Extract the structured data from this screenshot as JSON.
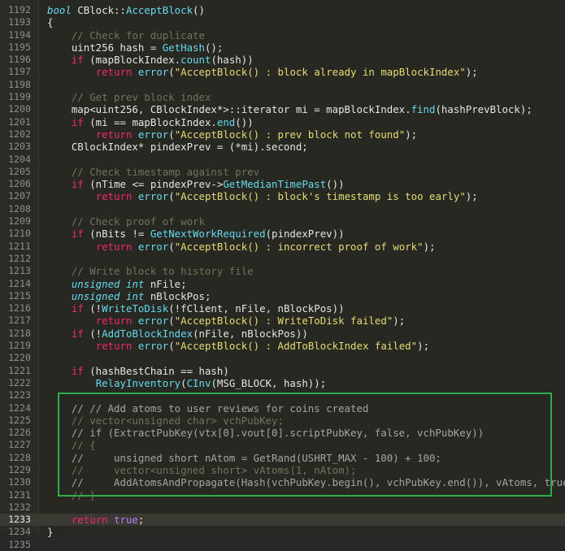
{
  "editor": {
    "current_line": 1233,
    "highlight_color": "#2dad4a",
    "lines": [
      {
        "num": "1192",
        "segs": [
          [
            "type",
            "bool"
          ],
          [
            "pl",
            " CBlock::"
          ],
          [
            "fn",
            "AcceptBlock"
          ],
          [
            "pl",
            "()"
          ]
        ]
      },
      {
        "num": "1193",
        "segs": [
          [
            "pl",
            "{"
          ]
        ]
      },
      {
        "num": "1194",
        "segs": [
          [
            "pl",
            "    "
          ],
          [
            "com",
            "// Check for duplicate"
          ]
        ]
      },
      {
        "num": "1195",
        "segs": [
          [
            "pl",
            "    uint256 hash = "
          ],
          [
            "fn",
            "GetHash"
          ],
          [
            "pl",
            "();"
          ]
        ]
      },
      {
        "num": "1196",
        "segs": [
          [
            "pl",
            "    "
          ],
          [
            "kw",
            "if"
          ],
          [
            "pl",
            " (mapBlockIndex."
          ],
          [
            "fn",
            "count"
          ],
          [
            "pl",
            "(hash))"
          ]
        ]
      },
      {
        "num": "1197",
        "segs": [
          [
            "pl",
            "        "
          ],
          [
            "kw",
            "return"
          ],
          [
            "pl",
            " "
          ],
          [
            "fn",
            "error"
          ],
          [
            "pl",
            "("
          ],
          [
            "str",
            "\"AcceptBlock() : block already in mapBlockIndex\""
          ],
          [
            "pl",
            ");"
          ]
        ]
      },
      {
        "num": "1198",
        "segs": []
      },
      {
        "num": "1199",
        "segs": [
          [
            "pl",
            "    "
          ],
          [
            "com",
            "// Get prev block index"
          ]
        ]
      },
      {
        "num": "1200",
        "segs": [
          [
            "pl",
            "    map<uint256, CBlockIndex*>::iterator mi = mapBlockIndex."
          ],
          [
            "fn",
            "find"
          ],
          [
            "pl",
            "(hashPrevBlock);"
          ]
        ]
      },
      {
        "num": "1201",
        "segs": [
          [
            "pl",
            "    "
          ],
          [
            "kw",
            "if"
          ],
          [
            "pl",
            " (mi == mapBlockIndex."
          ],
          [
            "fn",
            "end"
          ],
          [
            "pl",
            "())"
          ]
        ]
      },
      {
        "num": "1202",
        "segs": [
          [
            "pl",
            "        "
          ],
          [
            "kw",
            "return"
          ],
          [
            "pl",
            " "
          ],
          [
            "fn",
            "error"
          ],
          [
            "pl",
            "("
          ],
          [
            "str",
            "\"AcceptBlock() : prev block not found\""
          ],
          [
            "pl",
            ");"
          ]
        ]
      },
      {
        "num": "1203",
        "segs": [
          [
            "pl",
            "    CBlockIndex* pindexPrev = (*mi).second;"
          ]
        ]
      },
      {
        "num": "1204",
        "segs": []
      },
      {
        "num": "1205",
        "segs": [
          [
            "pl",
            "    "
          ],
          [
            "com",
            "// Check timestamp against prev"
          ]
        ]
      },
      {
        "num": "1206",
        "segs": [
          [
            "pl",
            "    "
          ],
          [
            "kw",
            "if"
          ],
          [
            "pl",
            " (nTime <= pindexPrev->"
          ],
          [
            "fn",
            "GetMedianTimePast"
          ],
          [
            "pl",
            "())"
          ]
        ]
      },
      {
        "num": "1207",
        "segs": [
          [
            "pl",
            "        "
          ],
          [
            "kw",
            "return"
          ],
          [
            "pl",
            " "
          ],
          [
            "fn",
            "error"
          ],
          [
            "pl",
            "("
          ],
          [
            "str",
            "\"AcceptBlock() : block's timestamp is too early\""
          ],
          [
            "pl",
            ");"
          ]
        ]
      },
      {
        "num": "1208",
        "segs": []
      },
      {
        "num": "1209",
        "segs": [
          [
            "pl",
            "    "
          ],
          [
            "com",
            "// Check proof of work"
          ]
        ]
      },
      {
        "num": "1210",
        "segs": [
          [
            "pl",
            "    "
          ],
          [
            "kw",
            "if"
          ],
          [
            "pl",
            " (nBits != "
          ],
          [
            "fn",
            "GetNextWorkRequired"
          ],
          [
            "pl",
            "(pindexPrev))"
          ]
        ]
      },
      {
        "num": "1211",
        "segs": [
          [
            "pl",
            "        "
          ],
          [
            "kw",
            "return"
          ],
          [
            "pl",
            " "
          ],
          [
            "fn",
            "error"
          ],
          [
            "pl",
            "("
          ],
          [
            "str",
            "\"AcceptBlock() : incorrect proof of work\""
          ],
          [
            "pl",
            ");"
          ]
        ]
      },
      {
        "num": "1212",
        "segs": []
      },
      {
        "num": "1213",
        "segs": [
          [
            "pl",
            "    "
          ],
          [
            "com",
            "// Write block to history file"
          ]
        ]
      },
      {
        "num": "1214",
        "segs": [
          [
            "pl",
            "    "
          ],
          [
            "type",
            "unsigned int"
          ],
          [
            "pl",
            " nFile;"
          ]
        ]
      },
      {
        "num": "1215",
        "segs": [
          [
            "pl",
            "    "
          ],
          [
            "type",
            "unsigned int"
          ],
          [
            "pl",
            " nBlockPos;"
          ]
        ]
      },
      {
        "num": "1216",
        "segs": [
          [
            "pl",
            "    "
          ],
          [
            "kw",
            "if"
          ],
          [
            "pl",
            " (!"
          ],
          [
            "fn",
            "WriteToDisk"
          ],
          [
            "pl",
            "(!fClient, nFile, nBlockPos))"
          ]
        ]
      },
      {
        "num": "1217",
        "segs": [
          [
            "pl",
            "        "
          ],
          [
            "kw",
            "return"
          ],
          [
            "pl",
            " "
          ],
          [
            "fn",
            "error"
          ],
          [
            "pl",
            "("
          ],
          [
            "str",
            "\"AcceptBlock() : WriteToDisk failed\""
          ],
          [
            "pl",
            ");"
          ]
        ]
      },
      {
        "num": "1218",
        "segs": [
          [
            "pl",
            "    "
          ],
          [
            "kw",
            "if"
          ],
          [
            "pl",
            " (!"
          ],
          [
            "fn",
            "AddToBlockIndex"
          ],
          [
            "pl",
            "(nFile, nBlockPos))"
          ]
        ]
      },
      {
        "num": "1219",
        "segs": [
          [
            "pl",
            "        "
          ],
          [
            "kw",
            "return"
          ],
          [
            "pl",
            " "
          ],
          [
            "fn",
            "error"
          ],
          [
            "pl",
            "("
          ],
          [
            "str",
            "\"AcceptBlock() : AddToBlockIndex failed\""
          ],
          [
            "pl",
            ");"
          ]
        ]
      },
      {
        "num": "1220",
        "segs": []
      },
      {
        "num": "1221",
        "segs": [
          [
            "pl",
            "    "
          ],
          [
            "kw",
            "if"
          ],
          [
            "pl",
            " (hashBestChain == hash)"
          ]
        ]
      },
      {
        "num": "1222",
        "segs": [
          [
            "pl",
            "        "
          ],
          [
            "fn",
            "RelayInventory"
          ],
          [
            "pl",
            "("
          ],
          [
            "fn",
            "CInv"
          ],
          [
            "pl",
            "(MSG_BLOCK, hash));"
          ]
        ]
      },
      {
        "num": "1223",
        "segs": []
      },
      {
        "num": "1224",
        "segs": [
          [
            "pl",
            "    "
          ],
          [
            "gr",
            "// // Add atoms to user reviews for coins created"
          ]
        ]
      },
      {
        "num": "1225",
        "segs": [
          [
            "pl",
            "    "
          ],
          [
            "com",
            "// vector<unsigned char> vchPubKey;"
          ]
        ]
      },
      {
        "num": "1226",
        "segs": [
          [
            "pl",
            "    "
          ],
          [
            "gr",
            "// if (ExtractPubKey(vtx[0].vout[0].scriptPubKey, false, vchPubKey))"
          ]
        ]
      },
      {
        "num": "1227",
        "segs": [
          [
            "pl",
            "    "
          ],
          [
            "com",
            "// {"
          ]
        ]
      },
      {
        "num": "1228",
        "segs": [
          [
            "pl",
            "    "
          ],
          [
            "gr",
            "//     unsigned short nAtom = GetRand(USHRT_MAX - 100) + 100;"
          ]
        ]
      },
      {
        "num": "1229",
        "segs": [
          [
            "pl",
            "    "
          ],
          [
            "com",
            "//     vector<unsigned short> vAtoms(1, nAtom);"
          ]
        ]
      },
      {
        "num": "1230",
        "segs": [
          [
            "pl",
            "    "
          ],
          [
            "gr",
            "//     AddAtomsAndPropagate(Hash(vchPubKey.begin(), vchPubKey.end()), vAtoms, true);"
          ]
        ]
      },
      {
        "num": "1231",
        "segs": [
          [
            "pl",
            "    "
          ],
          [
            "com",
            "// }"
          ]
        ]
      },
      {
        "num": "1232",
        "segs": []
      },
      {
        "num": "1233",
        "segs": [
          [
            "pl",
            "    "
          ],
          [
            "kw",
            "return"
          ],
          [
            "pl",
            " "
          ],
          [
            "num",
            "true"
          ],
          [
            "pl",
            ";"
          ]
        ]
      },
      {
        "num": "1234",
        "segs": [
          [
            "pl",
            "}"
          ]
        ]
      },
      {
        "num": "1235",
        "segs": []
      }
    ]
  }
}
